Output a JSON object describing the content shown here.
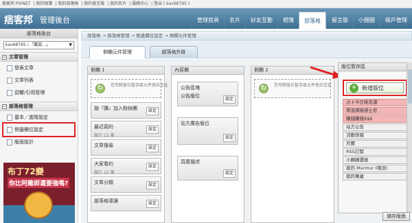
{
  "topbar": {
    "links": [
      "痞客邦 PIXNET",
      "我的相簿",
      "我的部落格",
      "我的留言版",
      "我的名片",
      "服務中心",
      "登出 ( kav68795 )"
    ]
  },
  "header": {
    "logo": "痞客邦",
    "title": "管理後台",
    "nav": [
      {
        "label": "管理首頁",
        "active": false
      },
      {
        "label": "名片",
        "active": false
      },
      {
        "label": "好友互動",
        "active": false
      },
      {
        "label": "相簿",
        "active": false
      },
      {
        "label": "部落格",
        "active": true
      },
      {
        "label": "留言版",
        "active": false
      },
      {
        "label": "小圈圈",
        "active": false
      },
      {
        "label": "帳戶管理",
        "active": false
      }
    ]
  },
  "sidebar": {
    "heading": "部落格後台",
    "account_select": "kav68795 / 『戴設...』",
    "sections": [
      {
        "title": "文章管理",
        "items": [
          "發表文章",
          "文章列表",
          "迴響/引用管理"
        ]
      },
      {
        "title": "部落格管理",
        "items": [
          "基本／進階設定",
          "側邊欄位設定",
          "版面設計"
        ]
      }
    ],
    "highlighted_item": "側邊欄位設定",
    "ad": {
      "line1": "布丁72變",
      "line2": "你比阿雞師還要強嗎?"
    }
  },
  "breadcrumb": "部落格 → 部落格管理 → 側邊欄位設定 → 側欄元件管理",
  "tabs": [
    {
      "label": "側欄元件管理",
      "active": true
    },
    {
      "label": "部落格外掛",
      "active": false
    }
  ],
  "columns": {
    "col1": {
      "title": "側欄 1",
      "drop_hint": "您可將版位暫存區元件拖拉至此",
      "modules": [
        {
          "label": "按『讚』加入粉絲團",
          "sub": ""
        },
        {
          "label": "最近寫的",
          "sub": "顯示 15 筆"
        },
        {
          "label": "文章搜尋",
          "sub": ""
        },
        {
          "label": "大家看的",
          "sub": "顯示 10 筆"
        },
        {
          "label": "文章分類",
          "sub": ""
        },
        {
          "label": "部落格導讀",
          "sub": ""
        }
      ]
    },
    "col_mid": {
      "title": "內容欄",
      "modules": [
        {
          "label": "公告區塊",
          "sub": "公告版位"
        },
        {
          "label": "站方廣告版位",
          "sub": ""
        },
        {
          "label": "頁尾描述",
          "sub": ""
        }
      ]
    },
    "col2": {
      "title": "側欄 2",
      "drop_hint": "您可將版位暫存區元件拖拉至此"
    }
  },
  "settings_label": "設定",
  "pool": {
    "title": "版位暫存區",
    "add_button": "新增版位",
    "items": [
      {
        "label": "占卜今日桃花運",
        "highlight": true
      },
      {
        "label": "學習讀後感士尼",
        "highlight": true
      },
      {
        "label": "賺錢賺錢$$$",
        "highlight": true
      },
      {
        "label": "站方公告",
        "highlight": false
      },
      {
        "label": "活動快報",
        "highlight": false
      },
      {
        "label": "月曆",
        "highlight": false
      },
      {
        "label": "RSS訂閱",
        "highlight": false
      },
      {
        "label": "小圈圈選拔",
        "highlight": false
      },
      {
        "label": "我的 Murmur (噗浪)",
        "highlight": false
      },
      {
        "label": "我的萬歲",
        "highlight": false
      }
    ]
  },
  "save_button": "儲存版面",
  "colors": {
    "header": "#4a7aa0",
    "highlight_red": "#e02020",
    "pool_red": "#f2b6b6",
    "add_green": "#5cab3b"
  }
}
